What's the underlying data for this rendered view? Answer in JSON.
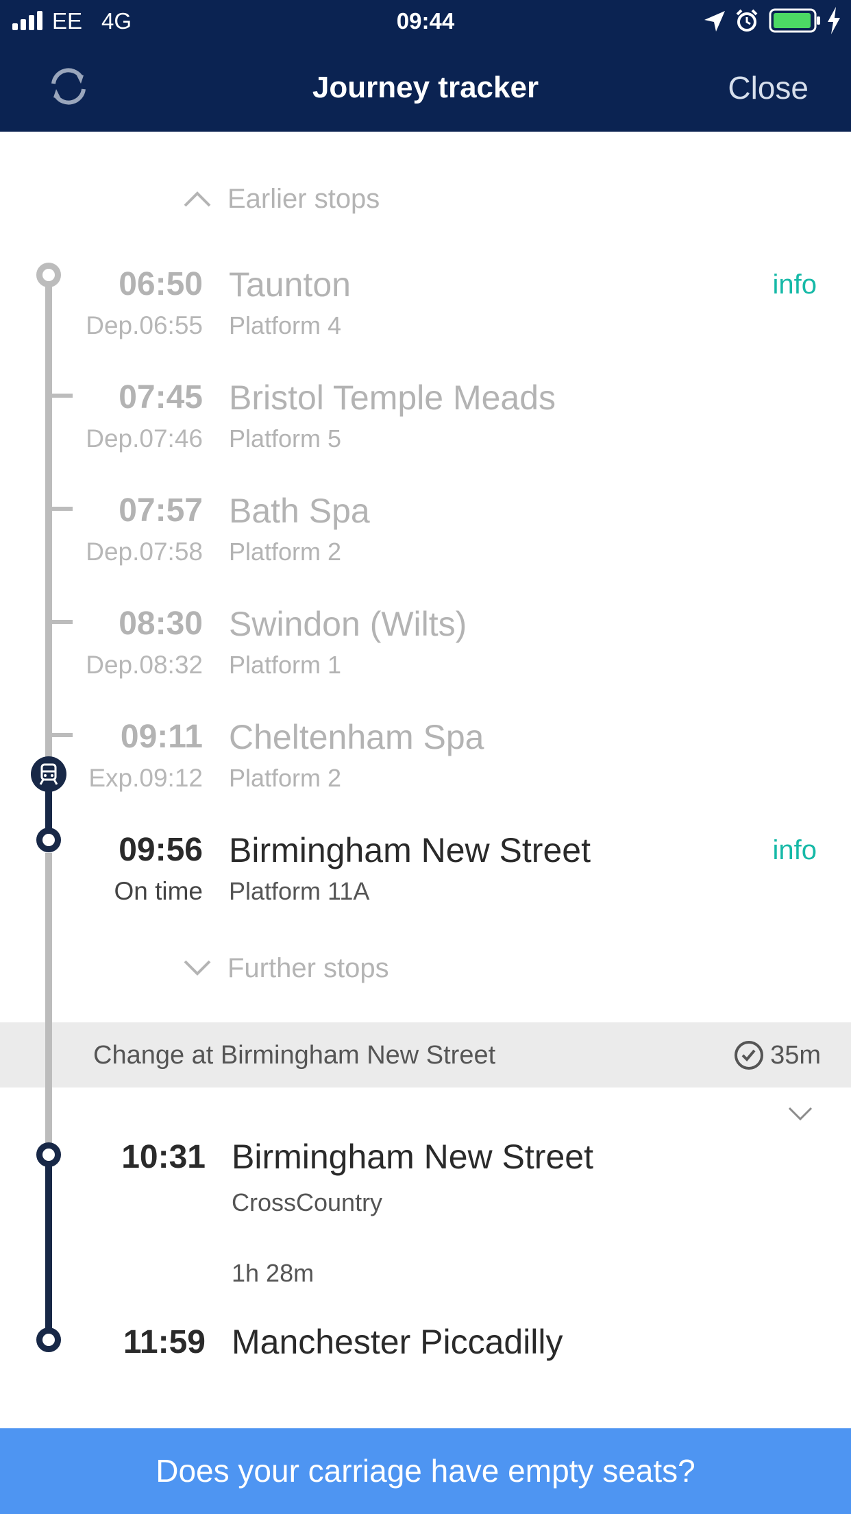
{
  "status_bar": {
    "carrier": "EE",
    "network": "4G",
    "time": "09:44"
  },
  "header": {
    "title": "Journey tracker",
    "close_label": "Close"
  },
  "earlier_stops_label": "Earlier stops",
  "stops": [
    {
      "time": "06:50",
      "sub": "Dep.06:55",
      "station": "Taunton",
      "platform": "Platform 4",
      "info": "info"
    },
    {
      "time": "07:45",
      "sub": "Dep.07:46",
      "station": "Bristol Temple Meads",
      "platform": "Platform 5"
    },
    {
      "time": "07:57",
      "sub": "Dep.07:58",
      "station": "Bath Spa",
      "platform": "Platform 2"
    },
    {
      "time": "08:30",
      "sub": "Dep.08:32",
      "station": "Swindon (Wilts)",
      "platform": "Platform 1"
    },
    {
      "time": "09:11",
      "sub": "Exp.09:12",
      "station": "Cheltenham Spa",
      "platform": "Platform 2"
    },
    {
      "time": "09:56",
      "sub": "On time",
      "station": "Birmingham New Street",
      "platform": "Platform 11A",
      "info": "info"
    }
  ],
  "further_stops_label": "Further stops",
  "change": {
    "label": "Change at Birmingham New Street",
    "duration": "35m"
  },
  "next_leg": {
    "departure": {
      "time": "10:31",
      "station": "Birmingham New Street",
      "operator": "CrossCountry"
    },
    "duration": "1h 28m",
    "arrival": {
      "time": "11:59",
      "station": "Manchester Piccadilly"
    }
  },
  "cta_label": "Does your carriage have empty seats?",
  "colors": {
    "header_bg": "#0b2352",
    "accent_info": "#16b9a7",
    "cta_bg": "#4e95f2",
    "navy_line": "#182847",
    "grey_line": "#bcbcbc"
  }
}
